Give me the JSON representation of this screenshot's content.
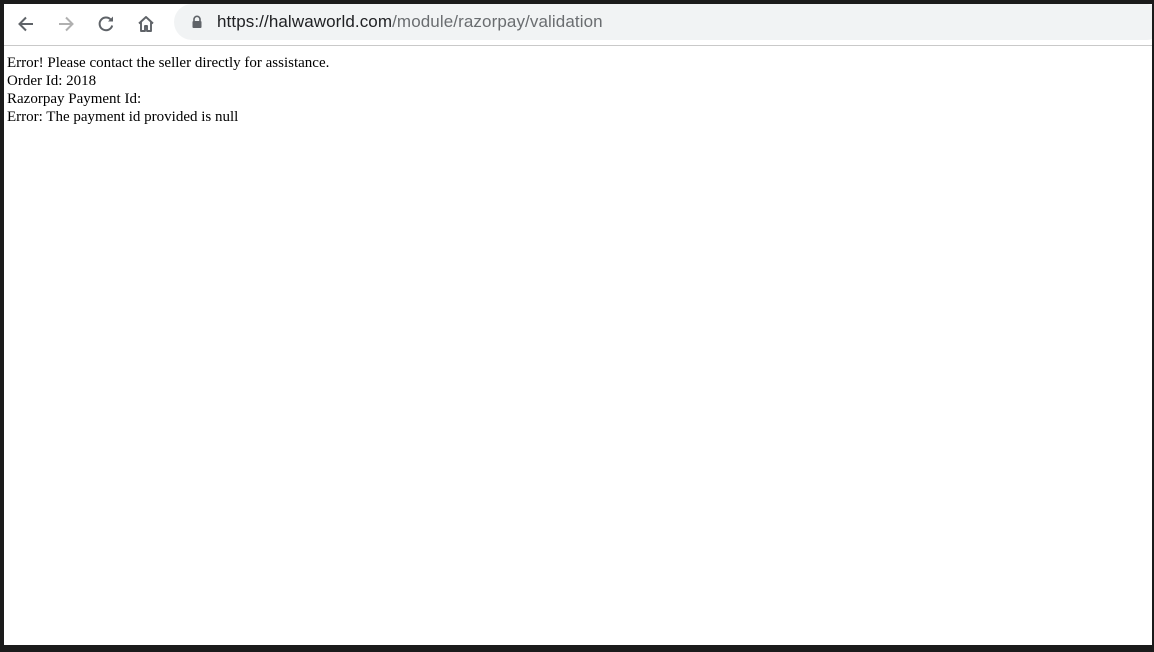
{
  "browser": {
    "icons": {
      "back": "arrow-left-icon",
      "forward": "arrow-right-icon",
      "reload": "reload-icon",
      "home": "home-icon",
      "lock": "lock-icon"
    },
    "address_bar": {
      "scheme": "https://",
      "host": "halwaworld.com",
      "path": "/module/razorpay/validation"
    }
  },
  "page": {
    "lines": [
      "Error! Please contact the seller directly for assistance.",
      "Order Id: 2018",
      "Razorpay Payment Id:",
      "Error: The payment id provided is null"
    ]
  },
  "colors": {
    "frame": "#1b1b1b",
    "omnibox": "#f1f3f4",
    "url_host": "#202124",
    "url_path": "#6a6d70",
    "icon": "#5f6368",
    "icon_disabled": "#b0b0b0"
  }
}
